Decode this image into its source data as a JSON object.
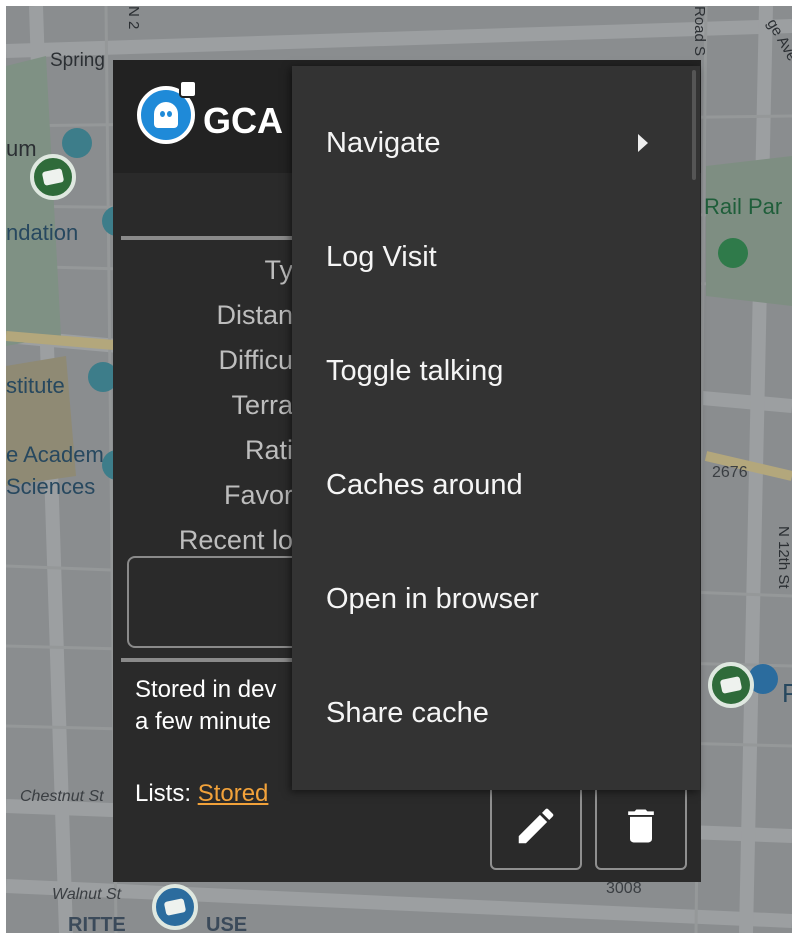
{
  "map": {
    "labels": {
      "spring": "Spring",
      "um": "um",
      "ndation": "ndation",
      "stitute": "stitute",
      "academy": "e Academ",
      "sciences": "Sciences",
      "rail_park": "Rail Par",
      "route_2676": "2676",
      "chestnut": "Chestnut St",
      "walnut": "Walnut St",
      "route_3008": "3008",
      "rittenhouse": "RITTE",
      "rittenhouse_end": "USE",
      "n_12th": "N 12th St",
      "road_s": "Road S",
      "ridge_ave": "ge Ave",
      "n2": "N 2",
      "p_letter": "P"
    },
    "colors": {
      "background": "#8a8d8f",
      "cache_pin": "#2f6b3a",
      "poi_blue": "#2b6c9e"
    }
  },
  "popup": {
    "cache_code": "GCA",
    "detail_labels": [
      "Ty",
      "Distan",
      "Difficu",
      "Terra",
      "Rati",
      "Favor",
      "Recent lo"
    ],
    "stored_line1": "Stored in dev",
    "stored_line2": "a few minute",
    "lists_prefix": "Lists: ",
    "lists_link": "Stored"
  },
  "menu": {
    "items": [
      {
        "label": "Navigate",
        "has_submenu": true
      },
      {
        "label": "Log Visit",
        "has_submenu": false
      },
      {
        "label": "Toggle talking",
        "has_submenu": false
      },
      {
        "label": "Caches around",
        "has_submenu": false
      },
      {
        "label": "Open in browser",
        "has_submenu": false
      },
      {
        "label": "Share cache",
        "has_submenu": false
      }
    ]
  }
}
